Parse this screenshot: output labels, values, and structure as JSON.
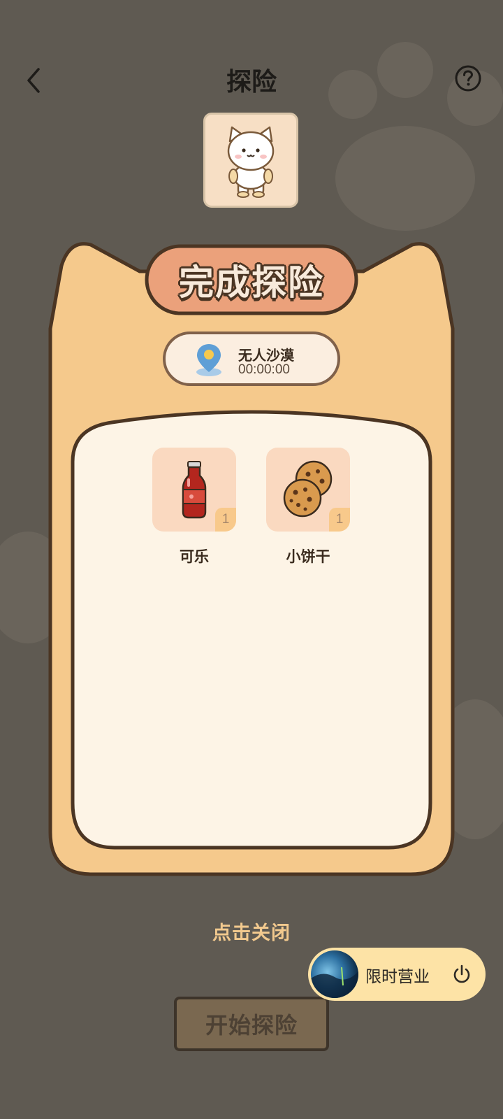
{
  "header": {
    "title": "探险",
    "back_icon": "chevron-left-icon",
    "help_icon": "question-circle-icon"
  },
  "card": {
    "title": "完成探险",
    "location": {
      "name": "无人沙漠",
      "time": "00:00:00",
      "icon": "map-pin-icon"
    },
    "rewards": [
      {
        "name": "可乐",
        "count": "1",
        "icon": "cola-bottle-icon"
      },
      {
        "name": "小饼干",
        "count": "1",
        "icon": "cookie-icon"
      }
    ]
  },
  "close_hint": "点击关闭",
  "start_button": "开始探险",
  "floating_bar": {
    "label": "限时营业",
    "icon": "power-icon"
  },
  "colors": {
    "overlay": "#5f5a52",
    "card_fill": "#f5c98c",
    "card_outline": "#4b3523",
    "title_badge": "#eba17b",
    "panel_fill": "#fdf4e6",
    "hint_text": "#f2c98e"
  }
}
